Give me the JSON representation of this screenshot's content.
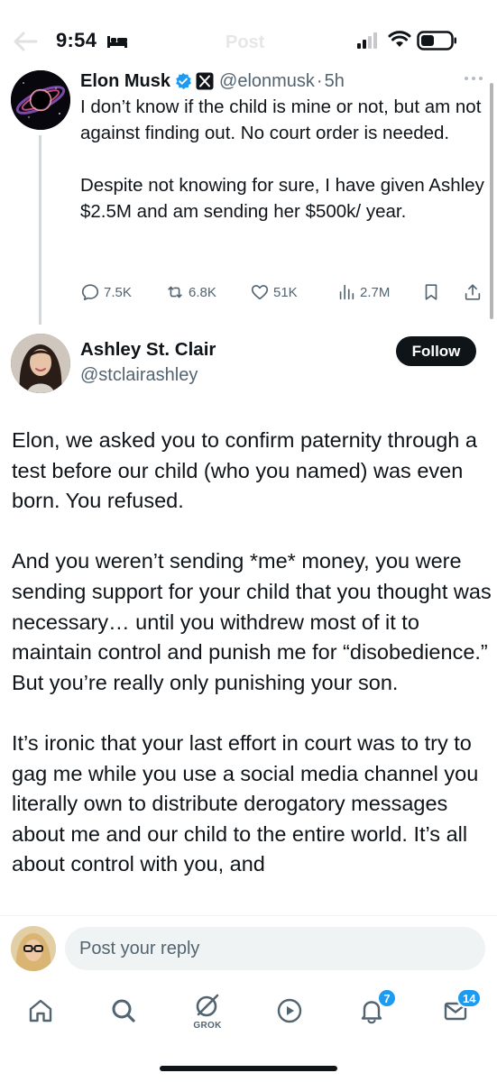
{
  "status_bar": {
    "time": "9:54",
    "ghost_title": "Post"
  },
  "parent_tweet": {
    "author_name": "Elon Musk",
    "handle": "@elonmusk",
    "separator": "·",
    "time_ago": "5h",
    "paragraphs": [
      "I don’t know if the child is mine or not, but am not against finding out. No court order is needed.",
      "Despite not knowing for sure, I have given Ashley $2.5M and am sending her $500k/ year."
    ],
    "stats": {
      "replies": "7.5K",
      "reposts": "6.8K",
      "likes": "51K",
      "views": "2.7M"
    }
  },
  "main_tweet": {
    "author_name": "Ashley St. Clair",
    "handle": "@stclairashley",
    "follow_label": "Follow",
    "paragraphs": [
      "Elon, we asked you to confirm paternity through a test before our child (who you named) was even born. You refused.",
      "And you weren’t sending *me* money, you were sending support for your child that you thought was necessary… until you withdrew most of it to maintain control and punish me for “disobedience.” But you’re really only punishing your son.",
      "It’s ironic that your last effort in court was to try to gag me while you use a social media channel you literally own to distribute derogatory messages about me and our child to the entire world. It’s all about control with you, and"
    ]
  },
  "reply": {
    "placeholder": "Post your reply"
  },
  "bottom_nav": {
    "grok_label": "GROK",
    "notifications_badge": "7",
    "messages_badge": "14"
  },
  "colors": {
    "text_primary": "#0f1419",
    "text_secondary": "#536471",
    "accent": "#1d9bf0",
    "follow_bg": "#0f1419"
  },
  "icons": [
    "back-arrow-icon",
    "bed-icon",
    "signal-icon",
    "wifi-icon",
    "battery-icon",
    "verified-icon",
    "x-logo-icon",
    "more-icon",
    "reply-icon",
    "repost-icon",
    "like-icon",
    "views-icon",
    "bookmark-icon",
    "share-icon",
    "home-icon",
    "search-icon",
    "grok-icon",
    "play-icon",
    "bell-icon",
    "mail-icon"
  ]
}
